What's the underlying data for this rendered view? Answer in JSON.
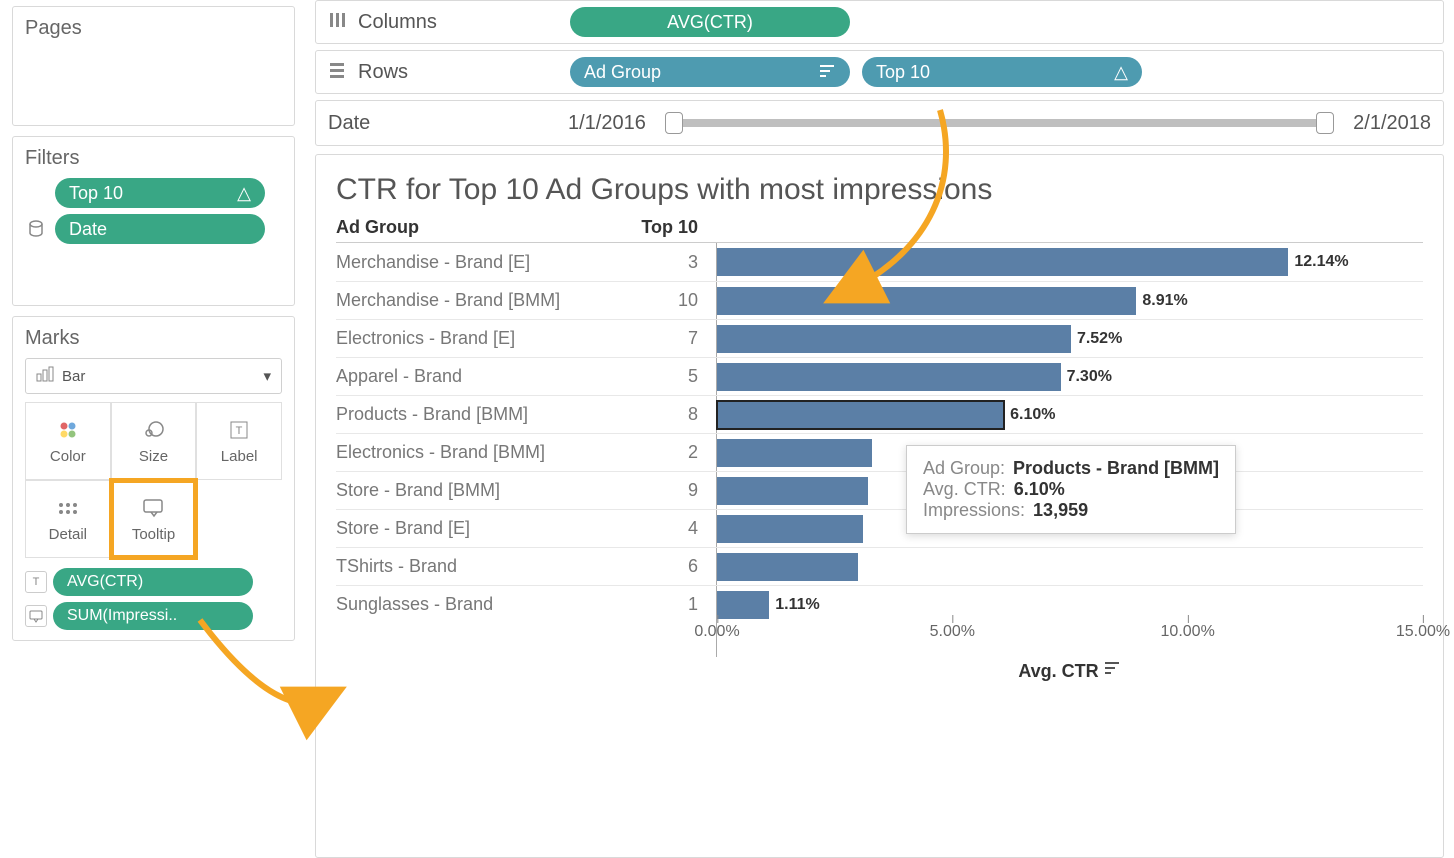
{
  "cards": {
    "pages_title": "Pages",
    "filters_title": "Filters",
    "marks_title": "Marks"
  },
  "filters": {
    "top10_pill": "Top 10",
    "date_pill": "Date"
  },
  "shelves": {
    "columns_label": "Columns",
    "rows_label": "Rows",
    "columns_pill": "AVG(CTR)",
    "rows_pill1": "Ad Group",
    "rows_pill2": "Top 10"
  },
  "date_filter": {
    "label": "Date",
    "start": "1/1/2016",
    "end": "2/1/2018"
  },
  "marks": {
    "type_label": "Bar",
    "buttons": [
      "Color",
      "Size",
      "Label",
      "Detail",
      "Tooltip",
      ""
    ],
    "pill1": "AVG(CTR)",
    "pill2": "SUM(Impressi.."
  },
  "chart": {
    "title": "CTR for Top 10 Ad Groups with most impressions",
    "header_group": "Ad Group",
    "header_top10": "Top 10",
    "axis_label": "Avg. CTR",
    "ticks": [
      "0.00%",
      "5.00%",
      "10.00%",
      "15.00%"
    ]
  },
  "tooltip": {
    "l1": "Ad Group:",
    "v1": "Products - Brand [BMM]",
    "l2": "Avg. CTR:",
    "v2": "6.10%",
    "l3": "Impressions:",
    "v3": "13,959"
  },
  "chart_data": {
    "type": "bar",
    "title": "CTR for Top 10 Ad Groups with most impressions",
    "xlabel": "Avg. CTR",
    "xlim_percent": [
      0,
      15
    ],
    "categories": [
      "Merchandise - Brand [E]",
      "Merchandise - Brand [BMM]",
      "Electronics - Brand [E]",
      "Apparel - Brand",
      "Products - Brand [BMM]",
      "Electronics - Brand [BMM]",
      "Store - Brand [BMM]",
      "Store - Brand [E]",
      "TShirts - Brand",
      "Sunglasses - Brand"
    ],
    "top10_rank": [
      3,
      10,
      7,
      5,
      8,
      2,
      9,
      4,
      6,
      1
    ],
    "values_percent": [
      12.14,
      8.91,
      7.52,
      7.3,
      6.1,
      3.3,
      3.2,
      3.1,
      3.0,
      1.11
    ],
    "value_labels": [
      "12.14%",
      "8.91%",
      "7.52%",
      "7.30%",
      "6.10%",
      "",
      "",
      "",
      "",
      "1.11%"
    ],
    "selected_index": 4,
    "tooltip_impressions": 13959
  }
}
